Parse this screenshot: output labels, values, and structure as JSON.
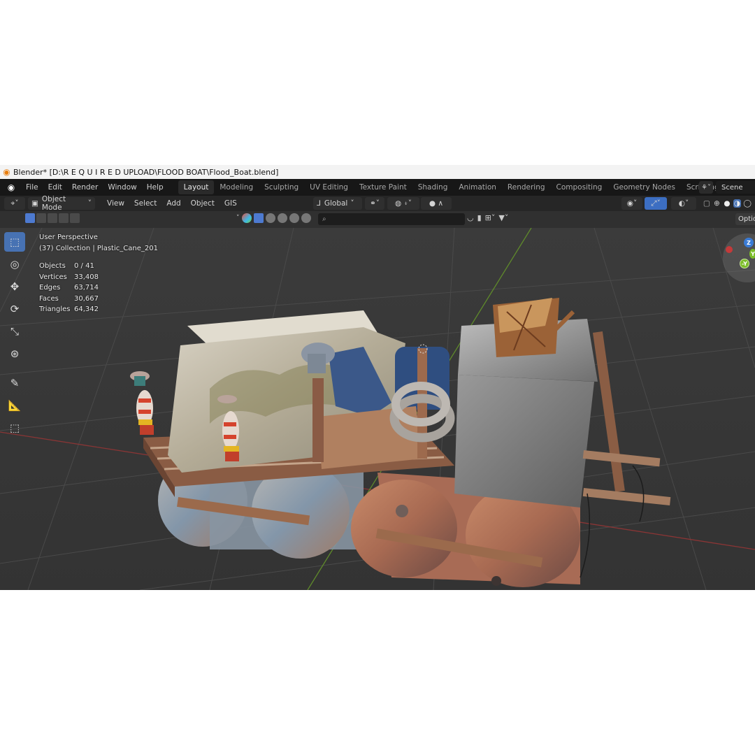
{
  "window": {
    "title": "Blender* [D:\\R E Q U I R E D   UPLOAD\\FLOOD BOAT\\Flood_Boat.blend]"
  },
  "menu": [
    "File",
    "Edit",
    "Render",
    "Window",
    "Help"
  ],
  "workspaces": [
    "Layout",
    "Modeling",
    "Sculpting",
    "UV Editing",
    "Texture Paint",
    "Shading",
    "Animation",
    "Rendering",
    "Compositing",
    "Geometry Nodes",
    "Scripting"
  ],
  "active_workspace": "Layout",
  "scene": {
    "name": "Scene"
  },
  "header": {
    "mode": "Object Mode",
    "view_menu": [
      "View",
      "Select",
      "Add",
      "Object",
      "GIS"
    ],
    "transform_orientation": "Global",
    "options_label": "Optio"
  },
  "viewport_info": {
    "view_name": "User Perspective",
    "collection": "(37) Collection | Plastic_Cane_201",
    "stats": [
      {
        "label": "Objects",
        "value": "0 / 41"
      },
      {
        "label": "Vertices",
        "value": "33,408"
      },
      {
        "label": "Edges",
        "value": "63,714"
      },
      {
        "label": "Faces",
        "value": "30,667"
      },
      {
        "label": "Triangles",
        "value": "64,342"
      }
    ]
  },
  "gizmo": {
    "axes": [
      "Z",
      "Y",
      "-Y"
    ]
  },
  "colors": {
    "accent": "#4772b3",
    "x_axis": "#c43a3a",
    "y_axis": "#7dbd2a",
    "z_axis": "#3a7bd5"
  },
  "icons": {
    "toolbar": [
      "select-box-icon",
      "cursor-icon",
      "move-icon",
      "rotate-icon",
      "scale-icon",
      "transform-icon",
      "annotate-icon",
      "measure-icon",
      "add-cube-icon"
    ]
  }
}
